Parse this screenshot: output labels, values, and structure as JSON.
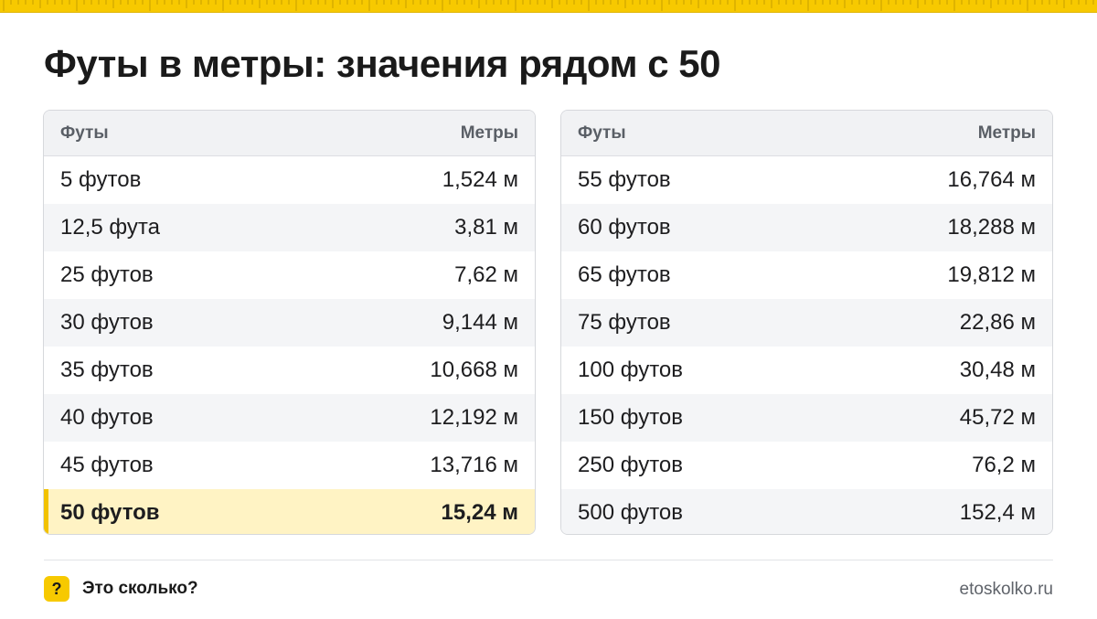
{
  "page": {
    "title": "Футы в метры: значения рядом с 50"
  },
  "colors": {
    "accent": "#f7c900",
    "highlight_bg": "#fff3c4",
    "header_bg": "#f1f2f4",
    "alt_row_bg": "#f4f5f7"
  },
  "tables": {
    "left": {
      "header": {
        "feet": "Футы",
        "meters": "Метры"
      },
      "rows": [
        {
          "feet": "5 футов",
          "meters": "1,524 м"
        },
        {
          "feet": "12,5 фута",
          "meters": "3,81 м"
        },
        {
          "feet": "25 футов",
          "meters": "7,62 м"
        },
        {
          "feet": "30 футов",
          "meters": "9,144 м"
        },
        {
          "feet": "35 футов",
          "meters": "10,668 м"
        },
        {
          "feet": "40 футов",
          "meters": "12,192 м"
        },
        {
          "feet": "45 футов",
          "meters": "13,716 м"
        },
        {
          "feet": "50 футов",
          "meters": "15,24 м",
          "highlighted": true
        }
      ]
    },
    "right": {
      "header": {
        "feet": "Футы",
        "meters": "Метры"
      },
      "rows": [
        {
          "feet": "55 футов",
          "meters": "16,764 м"
        },
        {
          "feet": "60 футов",
          "meters": "18,288 м"
        },
        {
          "feet": "65 футов",
          "meters": "19,812 м"
        },
        {
          "feet": "75 футов",
          "meters": "22,86 м"
        },
        {
          "feet": "100 футов",
          "meters": "30,48 м"
        },
        {
          "feet": "150 футов",
          "meters": "45,72 м"
        },
        {
          "feet": "250 футов",
          "meters": "76,2 м"
        },
        {
          "feet": "500 футов",
          "meters": "152,4 м"
        }
      ]
    }
  },
  "footer": {
    "badge": "?",
    "brand": "Это сколько?",
    "site": "etoskolko.ru"
  }
}
